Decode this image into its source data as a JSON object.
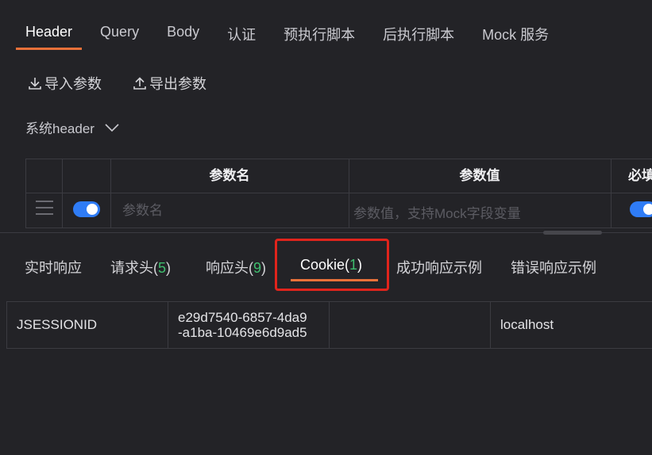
{
  "request_tabs": [
    {
      "label": "Header",
      "active": true
    },
    {
      "label": "Query"
    },
    {
      "label": "Body"
    },
    {
      "label": "认证"
    },
    {
      "label": "预执行脚本"
    },
    {
      "label": "后执行脚本"
    },
    {
      "label": "Mock 服务"
    }
  ],
  "actions": {
    "import_label": "导入参数",
    "export_label": "导出参数"
  },
  "system_header": {
    "label": "系统header"
  },
  "params_table": {
    "headers": {
      "name": "参数名",
      "value": "参数值",
      "required": "必填"
    },
    "placeholders": {
      "name": "参数名",
      "value": "参数值，支持Mock字段变量"
    },
    "row_enabled": true,
    "row_required": true
  },
  "response_tabs": [
    {
      "label": "实时响应"
    },
    {
      "label": "请求头(",
      "count": "5",
      "suffix": ")"
    },
    {
      "label": "响应头(",
      "count": "9",
      "suffix": ")"
    },
    {
      "label": "Cookie(",
      "count": "1",
      "suffix": ")",
      "active": true
    },
    {
      "label": "成功响应示例"
    },
    {
      "label": "错误响应示例"
    }
  ],
  "cookies": [
    {
      "name": "JSESSIONID",
      "value_line1": "e29d7540-6857-4da9",
      "value_line2": "-a1ba-10469e6d9ad5",
      "path": "",
      "domain": "localhost"
    }
  ],
  "colors": {
    "accent": "#e9713a",
    "toggle": "#2f7cf6",
    "count": "#3fbf6f",
    "highlight": "#e0241c",
    "background": "#232327"
  }
}
